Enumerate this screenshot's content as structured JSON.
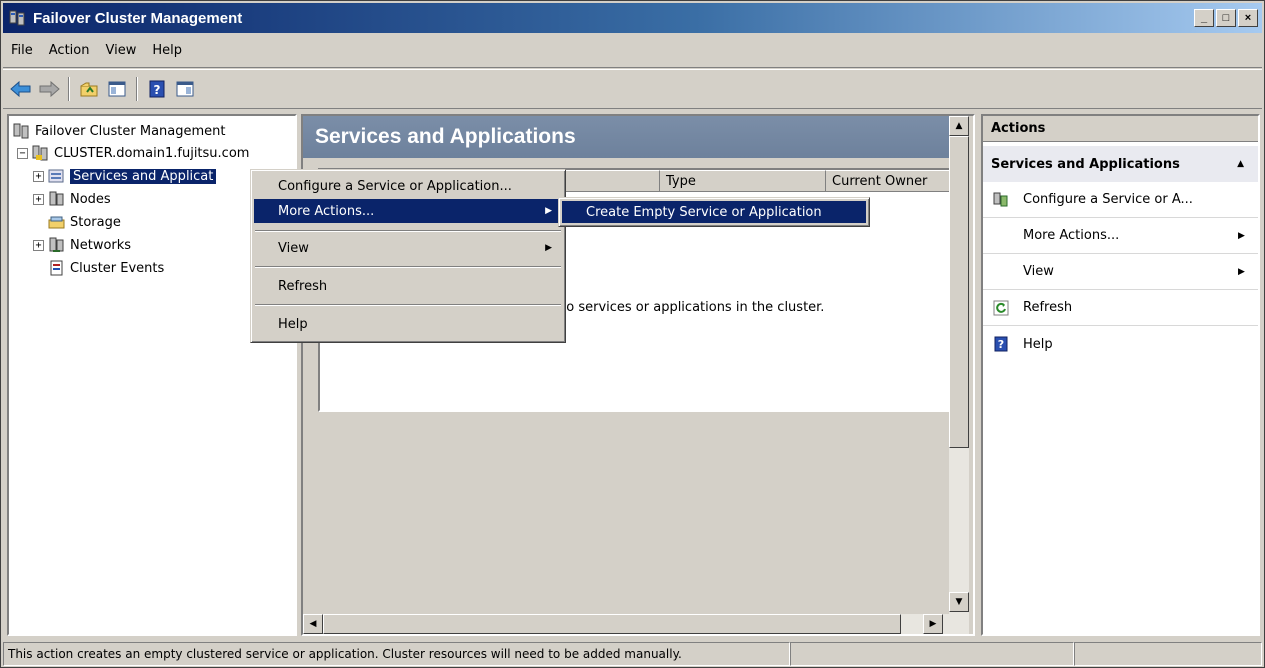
{
  "window": {
    "title": "Failover Cluster Management",
    "buttons": [
      "_",
      "□",
      "×"
    ]
  },
  "menubar": {
    "items": [
      "File",
      "Action",
      "View",
      "Help"
    ]
  },
  "toolbar": {
    "buttons": [
      "back-icon",
      "forward-icon",
      "up-folder-icon",
      "show-hide-tree-icon",
      "help-icon",
      "show-hide-action-pane-icon"
    ]
  },
  "tree": {
    "root": "Failover Cluster Management",
    "cluster": "CLUSTER.domain1.fujitsu.com",
    "items": [
      {
        "label": "Services and Applicat",
        "expander": "+"
      },
      {
        "label": "Nodes",
        "expander": "+"
      },
      {
        "label": "Storage",
        "expander": ""
      },
      {
        "label": "Networks",
        "expander": "+"
      },
      {
        "label": "Cluster Events",
        "expander": ""
      }
    ],
    "cluster_expander": "−"
  },
  "center": {
    "header": "Services and Applications",
    "columns": [
      "",
      "",
      "Type",
      "Current Owner"
    ],
    "empty_message": "no services or applications in the cluster."
  },
  "actions": {
    "title": "Actions",
    "section": "Services and Applications",
    "items": [
      {
        "label": "Configure a Service or A...",
        "icon": "configure-icon",
        "submenu": false
      },
      {
        "label": "More Actions...",
        "icon": "",
        "submenu": true
      },
      {
        "label": "View",
        "icon": "",
        "submenu": true
      },
      {
        "label": "Refresh",
        "icon": "refresh-icon",
        "submenu": false
      },
      {
        "label": "Help",
        "icon": "help-icon",
        "submenu": false
      }
    ]
  },
  "context_menu": {
    "items": [
      {
        "label": "Configure a Service or Application...",
        "submenu": false,
        "highlighted": false
      },
      {
        "label": "More Actions...",
        "submenu": true,
        "highlighted": true
      },
      {
        "label": "View",
        "submenu": true,
        "highlighted": false
      },
      {
        "label": "Refresh",
        "submenu": false,
        "highlighted": false
      },
      {
        "label": "Help",
        "submenu": false,
        "highlighted": false
      }
    ],
    "submenu_item": "Create Empty Service or Application"
  },
  "statusbar": {
    "message": "This action creates an empty clustered service or application. Cluster resources will need to be added manually."
  },
  "colors": {
    "selection": "#0a246a",
    "titlebar": "#0a246a",
    "header": "#7b8ea8"
  }
}
